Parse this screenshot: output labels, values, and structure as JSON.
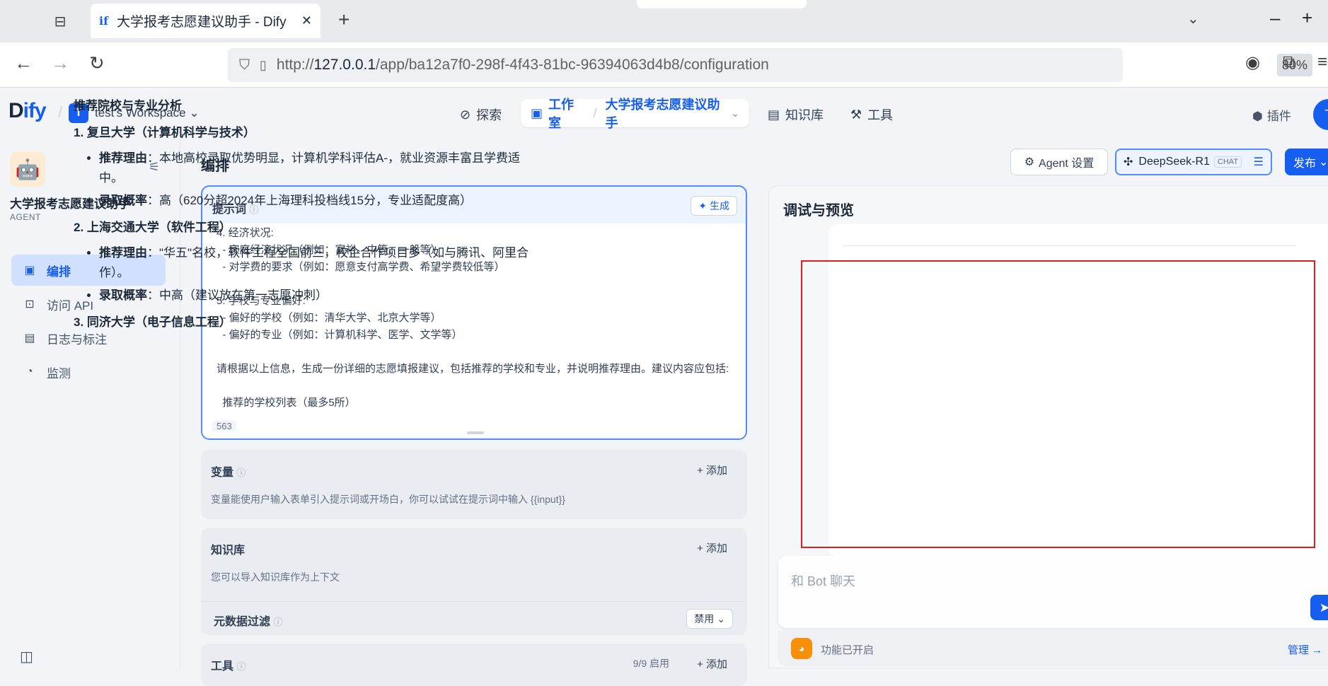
{
  "browser": {
    "tab_title": "大学报考志愿建议助手 - Dify",
    "favicon_text": "if",
    "url_prefix": "http://",
    "url_host": "127.0.0.1",
    "url_path": "/app/ba12a7f0-298f-4f43-81bc-96394063d4b8/configuration",
    "zoom": "80%"
  },
  "header": {
    "logo_d": "D",
    "logo_rest": "ify",
    "workspace_initial": "T",
    "workspace_name": "test's Workspace",
    "nav_explore": "探索",
    "nav_studio": "工作室",
    "current_app": "大学报考志愿建议助手",
    "nav_knowledge": "知识库",
    "nav_tools": "工具",
    "plugins": "插件",
    "user_initial": "T"
  },
  "sidebar": {
    "app_name": "大学报考志愿建议助手",
    "app_type": "AGENT",
    "items": [
      {
        "label": "编排",
        "icon": "layout-icon"
      },
      {
        "label": "访问 API",
        "icon": "terminal-icon"
      },
      {
        "label": "日志与标注",
        "icon": "file-icon"
      },
      {
        "label": "监测",
        "icon": "monitor-icon"
      }
    ]
  },
  "main": {
    "title": "编排",
    "prompt": {
      "label": "提示词",
      "generate": "生成",
      "text": "4. 经济状况:\n  - 家庭经济状况（例如：富裕、中等、一般等）\n  - 对学费的要求（例如：愿意支付高学费、希望学费较低等）\n\n5. 学校与专业偏好:\n  - 偏好的学校（例如：清华大学、北京大学等）\n  - 偏好的专业（例如：计算机科学、医学、文学等）\n\n请根据以上信息，生成一份详细的志愿填报建议，包括推荐的学校和专业，并说明推荐理由。建议内容应包括:\n\n  推荐的学校列表（最多5所）",
      "count": "563"
    },
    "variables": {
      "title": "变量",
      "add": "+ 添加",
      "desc": "变量能使用户输入表单引入提示词或开场白，你可以试试在提示词中输入 {{input}}"
    },
    "knowledge": {
      "title": "知识库",
      "add": "+ 添加",
      "desc": "您可以导入知识库作为上下文",
      "metadata_filter": "元数据过滤",
      "metadata_value": "禁用"
    },
    "tools": {
      "title": "工具",
      "count": "9/9 启用",
      "add": "+ 添加"
    }
  },
  "actions": {
    "agent_settings": "Agent 设置",
    "model": "DeepSeek-R1",
    "model_tag": "CHAT",
    "publish": "发布"
  },
  "preview": {
    "title": "调试与预览",
    "heading": "推荐院校与专业分析",
    "schools": [
      {
        "name": "1. 复旦大学（计算机科学与技术）",
        "reason_label": "推荐理由",
        "reason": "：本地高校录取优势明显，计算机学科评估A-，就业资源丰富且学费适中。",
        "prob_label": "录取概率",
        "prob": "：高（620分超2024年上海理科投档线15分，专业适配度高）"
      },
      {
        "name": "2. 上海交通大学（软件工程）",
        "reason_label": "推荐理由",
        "reason": "：\"华五\"名校，软件工程全国前三，校企合作项目多（如与腾讯、阿里合作）。",
        "prob_label": "录取概率",
        "prob": "：中高（建议放在第一志愿冲刺）"
      },
      {
        "name": "3. 同济大学（电子信息工程）"
      }
    ],
    "chat_placeholder": "和 Bot 聊天",
    "feature_text": "功能已开启",
    "manage": "管理 →"
  }
}
